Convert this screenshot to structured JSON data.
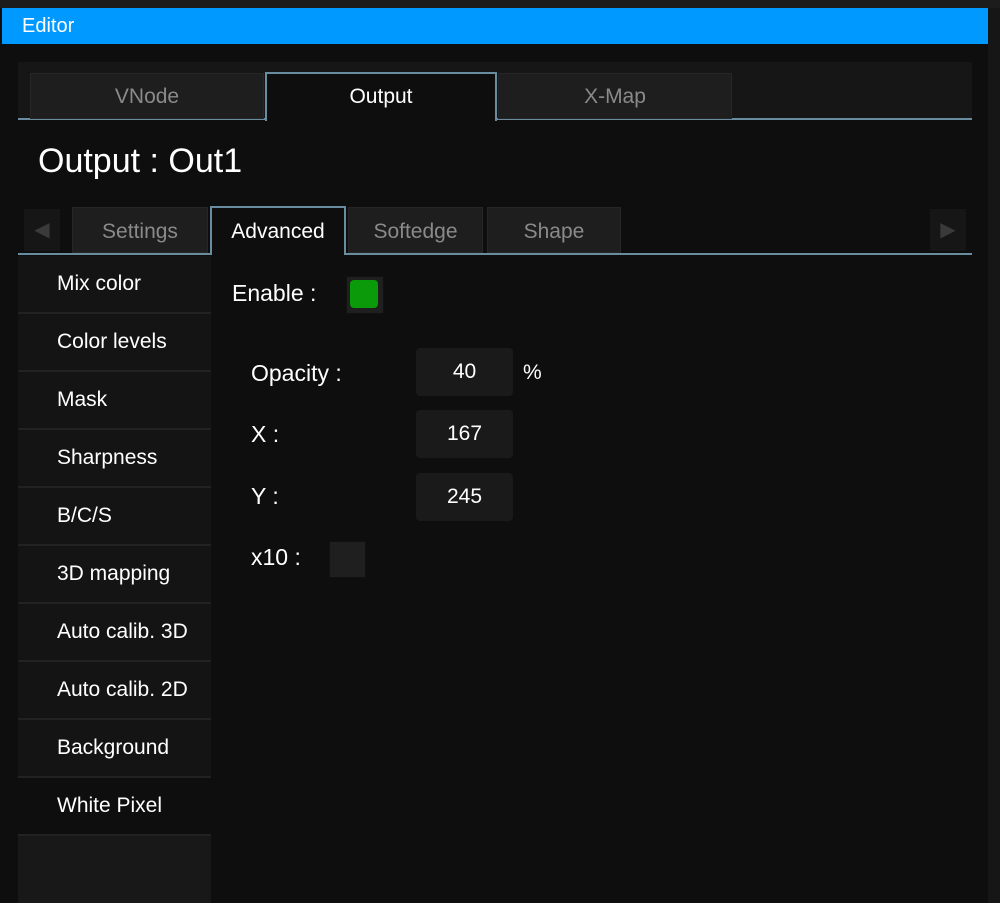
{
  "window": {
    "title": "Editor"
  },
  "main_tabs": [
    {
      "label": "VNode"
    },
    {
      "label": "Output"
    },
    {
      "label": "X-Map"
    }
  ],
  "page_title": "Output : Out1",
  "sub_tabs": [
    {
      "label": "Settings"
    },
    {
      "label": "Advanced"
    },
    {
      "label": "Softedge"
    },
    {
      "label": "Shape"
    }
  ],
  "sidebar": {
    "items": [
      {
        "label": "Mix color"
      },
      {
        "label": "Color levels"
      },
      {
        "label": "Mask"
      },
      {
        "label": "Sharpness"
      },
      {
        "label": "B/C/S"
      },
      {
        "label": "3D mapping"
      },
      {
        "label": "Auto calib. 3D"
      },
      {
        "label": "Auto calib. 2D"
      },
      {
        "label": "Background"
      },
      {
        "label": "White Pixel"
      }
    ]
  },
  "form": {
    "enable_label": "Enable :",
    "enable_checked": true,
    "opacity_label": "Opacity :",
    "opacity_value": "40",
    "opacity_unit": "%",
    "x_label": "X :",
    "x_value": "167",
    "y_label": "Y :",
    "y_value": "245",
    "x10_label": "x10 :",
    "x10_checked": false
  },
  "colors": {
    "title_bar": "#0099ff",
    "accent_line": "#6a8ca0",
    "enabled_green": "#0a9a0a"
  }
}
